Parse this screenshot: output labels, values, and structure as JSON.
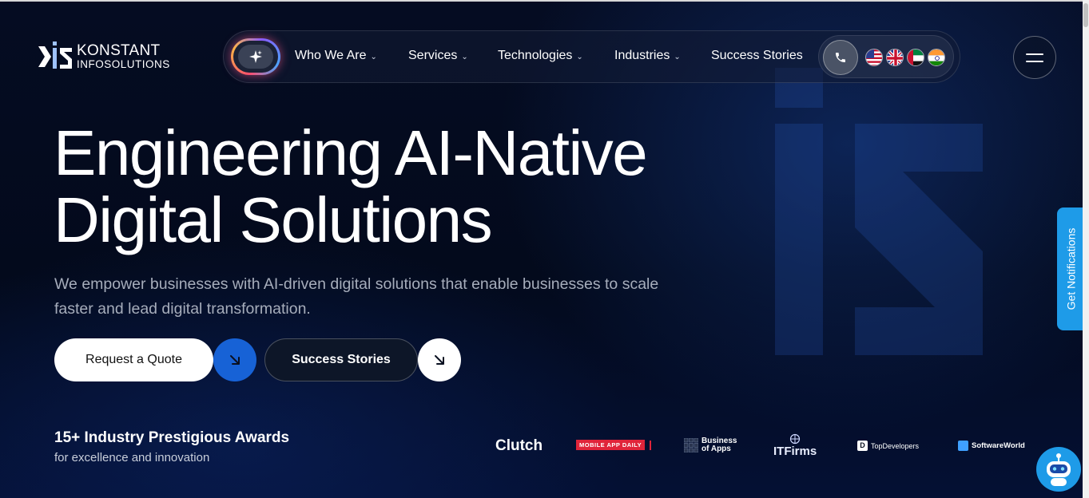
{
  "logo": {
    "line1": "KONSTANT",
    "line2": "INFOSOLUTIONS"
  },
  "nav": {
    "items": [
      {
        "label": "Who We Are",
        "dropdown": true
      },
      {
        "label": "Services",
        "dropdown": true
      },
      {
        "label": "Technologies",
        "dropdown": true
      },
      {
        "label": "Industries",
        "dropdown": true
      },
      {
        "label": "Success Stories",
        "dropdown": false
      }
    ],
    "flags": [
      "us-flag",
      "uk-flag",
      "uae-flag",
      "india-flag"
    ]
  },
  "hero": {
    "title_line1": "Engineering AI-Native",
    "title_line2": "Digital Solutions",
    "subtitle": "We empower businesses with AI-driven digital solutions that enable businesses to scale faster and lead digital transformation."
  },
  "cta": {
    "quote_label": "Request a Quote",
    "stories_label": "Success Stories"
  },
  "awards": {
    "title": "15+ Industry Prestigious Awards",
    "subtitle": "for excellence and innovation",
    "brands": {
      "clutch": "Clutch",
      "mobile_app_daily": "MOBILE APP DAILY",
      "business_of_apps_1": "Business",
      "business_of_apps_2": "of Apps",
      "itfirms": "ITFirms",
      "topdevelopers": "TopDevelopers",
      "softwareworld": "SoftwareWorld"
    }
  },
  "side": {
    "notifications": "Get Notifications"
  },
  "colors": {
    "accent": "#1762d6",
    "notify": "#1e9be8",
    "background": "#030a1c"
  }
}
